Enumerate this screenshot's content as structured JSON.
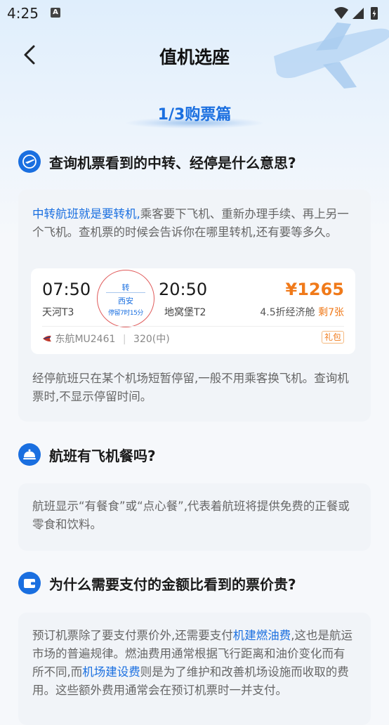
{
  "status_bar": {
    "time": "4:25",
    "notification_icon": "A"
  },
  "nav": {
    "title": "值机选座"
  },
  "section": {
    "title": "1/3购票篇"
  },
  "q1": {
    "title": "查询机票看到的中转、经停是什么意思?",
    "p1_highlight": "中转航班就是要转机,",
    "p1_rest": "乘客要下飞机、重新办理手续、再上另一个飞机。查机票的时候会告诉你在哪里转机,还有要等多久。",
    "flight": {
      "depart_time": "07:50",
      "depart_airport": "天河T3",
      "transfer_label": "转",
      "transfer_city": "西安",
      "transfer_wait": "停留7时15分",
      "arrive_time": "20:50",
      "arrive_airport": "地窝堡T2",
      "price": "¥1265",
      "cabin": "4.5折经济舱",
      "remaining": "剩7张",
      "airline": "东航MU2461",
      "aircraft": "320(中)",
      "tag": "礼包"
    },
    "p2": "经停航班只在某个机场短暂停留,一般不用乘客换飞机。查询机票时,不显示停留时间。"
  },
  "q2": {
    "title": "航班有飞机餐吗?",
    "p1": "航班显示“有餐食”或“点心餐”,代表着航班将提供免费的正餐或零食和饮料。"
  },
  "q3": {
    "title": "为什么需要支付的金额比看到的票价贵?",
    "p1_a": "预订机票除了要支付票价外,还需要支付",
    "p1_h1": "机建燃油费",
    "p1_b": ",这也是航运市场的普遍规律。燃油费用通常根据飞行距离和油价变化而有所不同,而",
    "p1_h2": "机场建设费",
    "p1_c": "则是为了维护和改善机场设施而收取的费用。这些额外费用通常会在预订机票时一并支付。"
  },
  "colors": {
    "accent": "#1a6fe0",
    "price": "#f07a1a",
    "stamp": "#e05a5a"
  }
}
